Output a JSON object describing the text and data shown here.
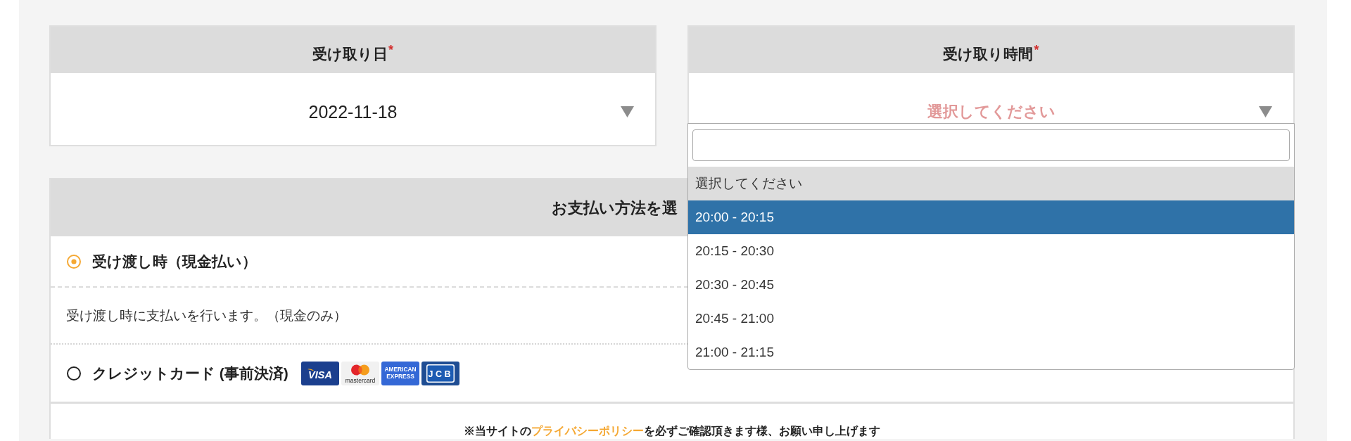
{
  "pickup_date": {
    "label": "受け取り日",
    "required_mark": "*",
    "value": "2022-11-18"
  },
  "pickup_time": {
    "label": "受け取り時間",
    "required_mark": "*",
    "placeholder": "選択してください",
    "expanded": true,
    "options": [
      {
        "label": "選択してください",
        "selected": true,
        "highlighted": false
      },
      {
        "label": "20:00 - 20:15",
        "selected": false,
        "highlighted": true
      },
      {
        "label": "20:15 - 20:30",
        "selected": false,
        "highlighted": false
      },
      {
        "label": "20:30 - 20:45",
        "selected": false,
        "highlighted": false
      },
      {
        "label": "20:45 - 21:00",
        "selected": false,
        "highlighted": false
      },
      {
        "label": "21:00 - 21:15",
        "selected": false,
        "highlighted": false
      }
    ]
  },
  "payment": {
    "title": "お支払い方法を選",
    "options": [
      {
        "label": "受け渡し時（現金払い）",
        "selected": true,
        "description": "受け渡し時に支払いを行います。（現金のみ）"
      },
      {
        "label": "クレジットカード (事前決済)",
        "selected": false,
        "cards": [
          {
            "kind": "visa",
            "lines": [
              "VISA"
            ]
          },
          {
            "kind": "mastercard",
            "lines": [
              "mastercard"
            ]
          },
          {
            "kind": "amex",
            "lines": [
              "AMERICAN",
              "EXPRESS"
            ]
          },
          {
            "kind": "jcb",
            "lines": [
              "JCB"
            ]
          }
        ]
      }
    ]
  },
  "notice": {
    "before": "※当サイトの",
    "link": "プライバシーポリシー",
    "after": "を必ずご確認頂きます様、お願い申し上げます"
  }
}
